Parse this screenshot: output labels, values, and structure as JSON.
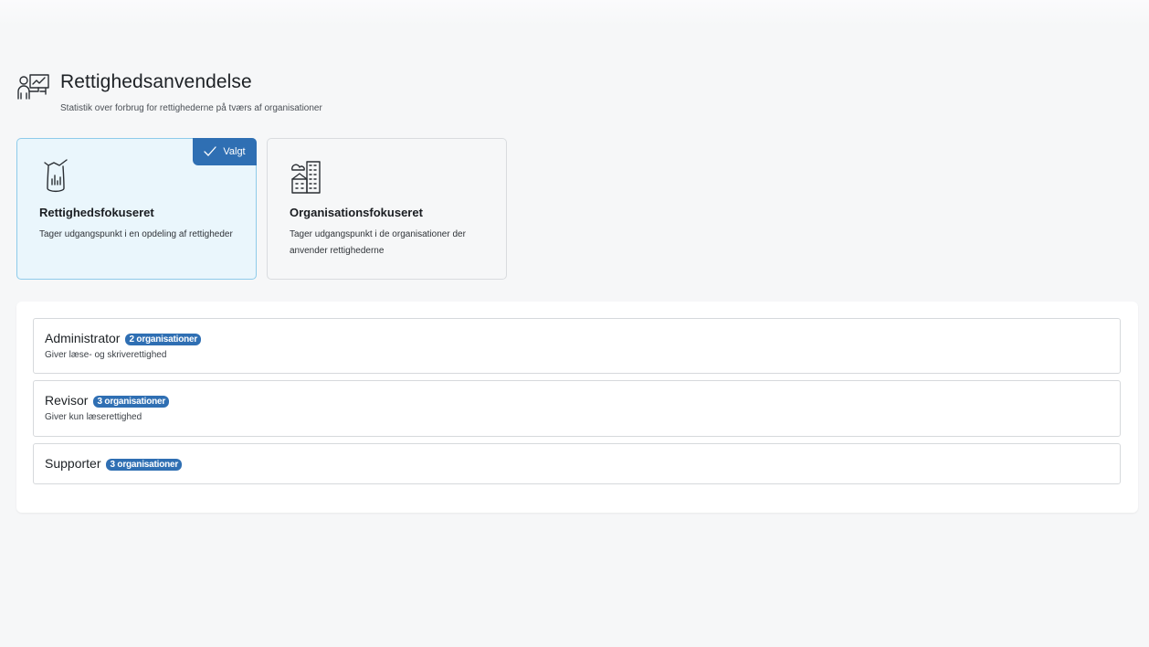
{
  "header": {
    "title": "Rettighedsanvendelse",
    "subtitle": "Statistik over forbrug for rettighederne på tværs af organisationer",
    "icon": "presenter-chart-icon"
  },
  "cards": [
    {
      "title": "Rettighedsfokuseret",
      "description": "Tager udgangspunkt i en opdeling af rettigheder",
      "icon": "trash-can-chart-icon",
      "selected": true,
      "selected_label": "Valgt"
    },
    {
      "title": "Organisationsfokuseret",
      "description": "Tager udgangspunkt i de organisationer der anvender rettighederne",
      "icon": "buildings-icon",
      "selected": false
    }
  ],
  "roles": [
    {
      "name": "Administrator",
      "count": "2 organisationer",
      "description": "Giver læse- og skriverettighed"
    },
    {
      "name": "Revisor",
      "count": "3 organisationer",
      "description": "Giver kun læserettighed"
    },
    {
      "name": "Supporter",
      "count": "3 organisationer",
      "description": ""
    }
  ],
  "colors": {
    "accent": "#2f6fb3",
    "selected_bg": "#eaf6fc",
    "selected_border": "#8ecbea"
  }
}
